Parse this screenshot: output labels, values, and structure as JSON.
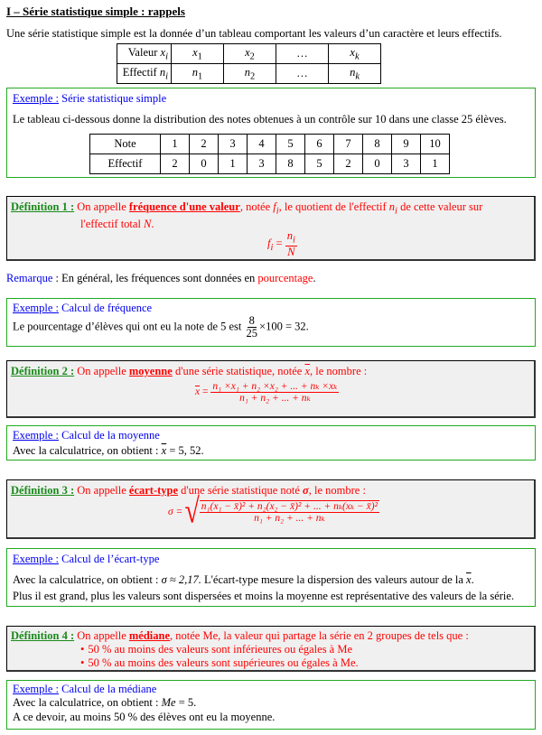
{
  "section_title": "I – Série statistique simple : rappels",
  "intro": "Une série statistique simple est la donnée d’un tableau comportant les valeurs d’un caractère et leurs effectifs.",
  "general_table": {
    "rows": [
      {
        "header": "Valeur",
        "header_sym": "x",
        "header_sub": "i",
        "cells": [
          [
            "x",
            "1"
          ],
          [
            "x",
            "2"
          ],
          [
            "…",
            ""
          ],
          [
            "x",
            "k"
          ]
        ]
      },
      {
        "header": "Effectif",
        "header_sym": "n",
        "header_sub": "i",
        "cells": [
          [
            "n",
            "1"
          ],
          [
            "n",
            "2"
          ],
          [
            "…",
            ""
          ],
          [
            "n",
            "k"
          ]
        ]
      }
    ]
  },
  "example1": {
    "label": "Exemple :",
    "title": "Série statistique simple",
    "text": "Le tableau ci-dessous donne la distribution des notes obtenues à un contrôle sur 10 dans une classe 25 élèves.",
    "table": {
      "row_headers": [
        "Note",
        "Effectif"
      ],
      "notes": [
        "1",
        "2",
        "3",
        "4",
        "5",
        "6",
        "7",
        "8",
        "9",
        "10"
      ],
      "effectifs": [
        "2",
        "0",
        "1",
        "3",
        "8",
        "5",
        "2",
        "0",
        "3",
        "1"
      ]
    }
  },
  "def1": {
    "label": "Définition 1 :",
    "text_a": "On appelle ",
    "term": "fréquence d'une valeur",
    "text_b": ", notée ",
    "sym_f": "f",
    "sub_i": "i",
    "text_c": ", le quotient de l'effectif ",
    "sym_n": "n",
    "text_d": " de cette valeur sur",
    "line2": "l'effectif total ",
    "sym_N": "N",
    "period": ".",
    "formula_lhs": "f",
    "formula_eq": " = ",
    "formula_num": "n",
    "formula_den": "N"
  },
  "remark": {
    "label": "Remarque",
    "colon": " : En général, les fréquences sont données en ",
    "highlight": "pourcentage",
    "end": "."
  },
  "example2": {
    "label": "Exemple :",
    "title": "Calcul de fréquence",
    "text": "Le pourcentage d’élèves qui ont eu la note de 5 est ",
    "num": "8",
    "den": "25",
    "rest": "×100 = 32."
  },
  "def2": {
    "label": "Définition 2 :",
    "text_a": "On appelle ",
    "term": "moyenne",
    "text_b": " d'une série statistique, notée ",
    "sym": "x",
    "text_c": ", le nombre :",
    "formula_lhs": "x",
    "formula_num": "n₁ ×x₁ + n₂ ×x₂ + ... + nₖ ×xₖ",
    "formula_den": "n₁ + n₂ + ... + nₖ"
  },
  "example3": {
    "label": "Exemple :",
    "title": "Calcul de la moyenne",
    "text": "Avec la calculatrice, on obtient : ",
    "sym": "x",
    "value": " = 5, 52."
  },
  "def3": {
    "label": "Définition 3 :",
    "text_a": "On appelle ",
    "term": "écart-type",
    "text_b": " d'une série statistique noté ",
    "sym": "σ",
    "text_c": ", le nombre :",
    "formula_lhs": "σ =",
    "formula_num": "n₁(x₁ − x̄)² + n₂(x₂ − x̄)² + ... + nₖ(xₖ − x̄)²",
    "formula_den": "n₁ + n₂ + ... + nₖ"
  },
  "example4": {
    "label": "Exemple :",
    "title": "Calcul de l’écart-type",
    "line1_a": "Avec la calculatrice, on obtient : ",
    "line1_sym": "σ ≈ 2,17.",
    "line1_b": "  L'écart-type mesure la dispersion des valeurs autour de la ",
    "line1_x": "x",
    "line1_end": ".",
    "line2": "Plus il est grand, plus les valeurs sont dispersées et moins la moyenne est représentative des valeurs de la série."
  },
  "def4": {
    "label": "Définition 4 :",
    "text_a": "On appelle ",
    "term": "médiane",
    "text_b": ", notée Me, la valeur qui partage la série en 2 groupes de tels que :",
    "bullets": [
      "50 % au moins des valeurs sont inférieures ou égales à Me",
      "50 % au moins des valeurs sont supérieures ou égales à Me."
    ],
    "bullet_char": "•"
  },
  "example5": {
    "label": "Exemple :",
    "title": "Calcul de la médiane",
    "line1_a": "Avec la calculatrice, on obtient : ",
    "line1_sym": "Me",
    "line1_b": " = 5.",
    "line2": "A ce devoir, au moins 50 % des élèves ont eu la moyenne."
  }
}
